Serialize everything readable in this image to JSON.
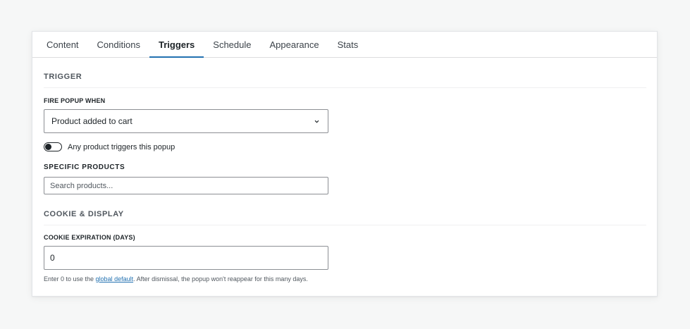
{
  "tabs": [
    {
      "label": "Content"
    },
    {
      "label": "Conditions"
    },
    {
      "label": "Triggers"
    },
    {
      "label": "Schedule"
    },
    {
      "label": "Appearance"
    },
    {
      "label": "Stats"
    }
  ],
  "active_tab": "Triggers",
  "trigger_section": {
    "heading": "TRIGGER",
    "fire_label": "FIRE POPUP WHEN",
    "fire_select_value": "Product added to cart",
    "toggle_label": "Any product triggers this popup",
    "toggle_on": false,
    "products_label": "SPECIFIC PRODUCTS",
    "products_placeholder": "Search products..."
  },
  "cookie_section": {
    "heading": "COOKIE & DISPLAY",
    "expiration_label": "COOKIE EXPIRATION (DAYS)",
    "expiration_value": "0",
    "help_before": "Enter 0 to use the ",
    "help_link": "global default",
    "help_after": ". After dismissal, the popup won't reappear for this many days."
  },
  "colors": {
    "accent": "#2271b1",
    "text": "#1d2327",
    "muted": "#50575e"
  },
  "icons": {
    "select_chevron": "chevron-down-icon"
  }
}
